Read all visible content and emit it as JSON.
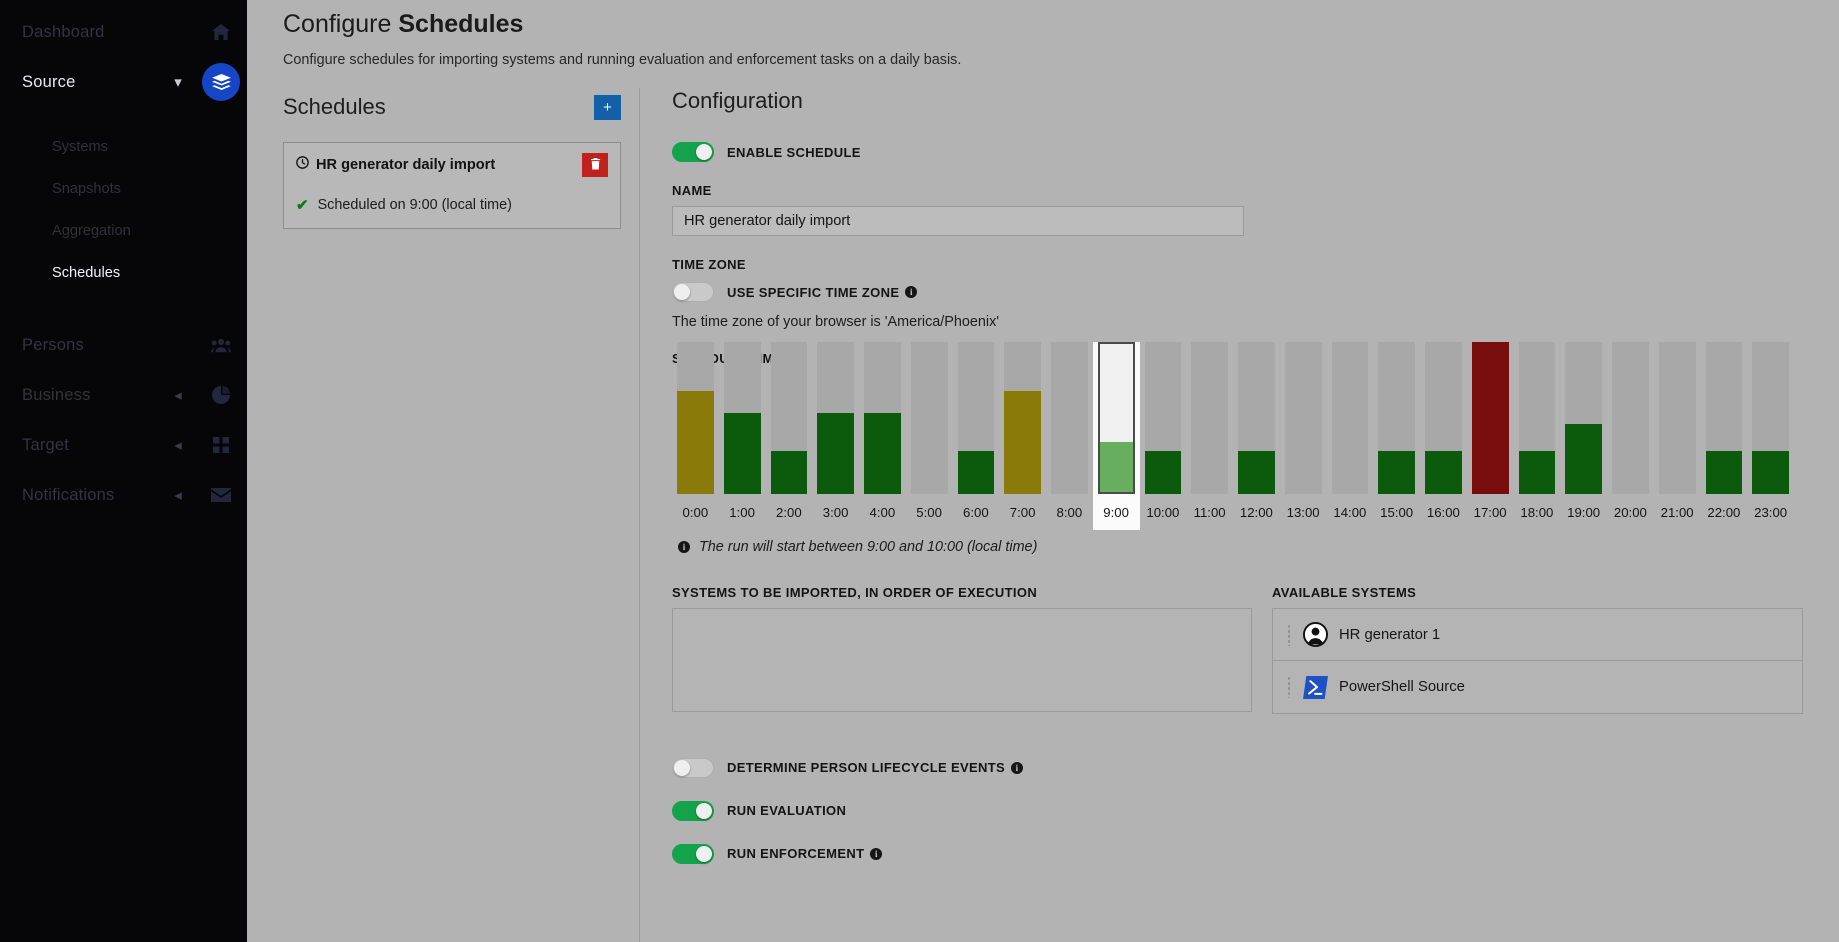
{
  "sidebar": {
    "items": [
      {
        "label": "Dashboard",
        "icon": "home-icon",
        "state": "dim",
        "chevron": null
      },
      {
        "label": "Source",
        "icon": "layers-icon",
        "state": "bright",
        "chevron": "chevron-down-icon"
      }
    ],
    "sub_items": [
      {
        "label": "Systems",
        "state": "dim"
      },
      {
        "label": "Snapshots",
        "state": "dim"
      },
      {
        "label": "Aggregation",
        "state": "dim"
      },
      {
        "label": "Schedules",
        "state": "selected"
      }
    ],
    "lower_items": [
      {
        "label": "Persons",
        "icon": "people-icon",
        "state": "dim",
        "chevron": null
      },
      {
        "label": "Business",
        "icon": "business-icon",
        "state": "dim",
        "chevron": "chevron-left-icon"
      },
      {
        "label": "Target",
        "icon": "grid-icon",
        "state": "dim",
        "chevron": "chevron-left-icon"
      },
      {
        "label": "Notifications",
        "icon": "envelope-icon",
        "state": "dim",
        "chevron": "chevron-left-icon"
      }
    ],
    "accent_color": "#1546c8"
  },
  "header": {
    "title_prefix": "Configure ",
    "title_bold": "Schedules",
    "subtitle": "Configure schedules for importing systems and running evaluation and enforcement tasks on a daily basis."
  },
  "schedules_panel": {
    "title": "Schedules",
    "add_label": "+",
    "card": {
      "name": "HR generator daily import",
      "clock_icon": "clock-icon",
      "delete_icon": "trash-icon",
      "status_icon": "check-icon",
      "status": "Scheduled on 9:00 (local time)"
    }
  },
  "configuration": {
    "title": "Configuration",
    "enable_schedule": {
      "label": "ENABLE SCHEDULE",
      "on": true
    },
    "name_label": "NAME",
    "name_value": "HR generator daily import",
    "name_placeholder": "",
    "timezone_label": "TIME ZONE",
    "use_specific_tz": {
      "label": "USE SPECIFIC TIME ZONE",
      "on": false,
      "info": true
    },
    "tz_note": "The time zone of your browser is 'America/Phoenix'",
    "schedule_time_label": "SCHEDULE TIME",
    "run_note": "The run will start between 9:00 and 10:00 (local time)",
    "systems_label": "SYSTEMS TO BE IMPORTED, IN ORDER OF EXECUTION",
    "available_label": "AVAILABLE SYSTEMS",
    "available_systems": [
      {
        "name": "HR generator 1",
        "icon": "person-avatar-icon"
      },
      {
        "name": "PowerShell Source",
        "icon": "powershell-icon"
      }
    ],
    "bottom_toggles": [
      {
        "label": "DETERMINE PERSON LIFECYCLE EVENTS",
        "on": false,
        "info": true
      },
      {
        "label": "RUN EVALUATION",
        "on": true,
        "info": false
      },
      {
        "label": "RUN ENFORCEMENT",
        "on": true,
        "info": true
      }
    ]
  },
  "chart_data": {
    "type": "bar",
    "title": "SCHEDULE TIME",
    "xlabel": "",
    "ylabel": "",
    "ylim": [
      0,
      100
    ],
    "grid": false,
    "legend": null,
    "selected_category": "9:00",
    "colors": {
      "track": "#a8a8a8",
      "green": "#0c5b0c",
      "olive": "#8a7a09",
      "maroon": "#770d0d",
      "light_green": "#67ae5f"
    },
    "categories": [
      "0:00",
      "1:00",
      "2:00",
      "3:00",
      "4:00",
      "5:00",
      "6:00",
      "7:00",
      "8:00",
      "9:00",
      "10:00",
      "11:00",
      "12:00",
      "13:00",
      "14:00",
      "15:00",
      "16:00",
      "17:00",
      "18:00",
      "19:00",
      "20:00",
      "21:00",
      "22:00",
      "23:00"
    ],
    "values": [
      68,
      53,
      28,
      53,
      53,
      0,
      28,
      68,
      0,
      33,
      28,
      0,
      28,
      0,
      0,
      28,
      28,
      100,
      28,
      46,
      0,
      0,
      28,
      28
    ],
    "series_colors": [
      "olive",
      "green",
      "green",
      "green",
      "green",
      "none",
      "green",
      "olive",
      "none",
      "light_green",
      "green",
      "none",
      "green",
      "none",
      "none",
      "green",
      "green",
      "maroon",
      "green",
      "green",
      "none",
      "none",
      "green",
      "green"
    ]
  }
}
